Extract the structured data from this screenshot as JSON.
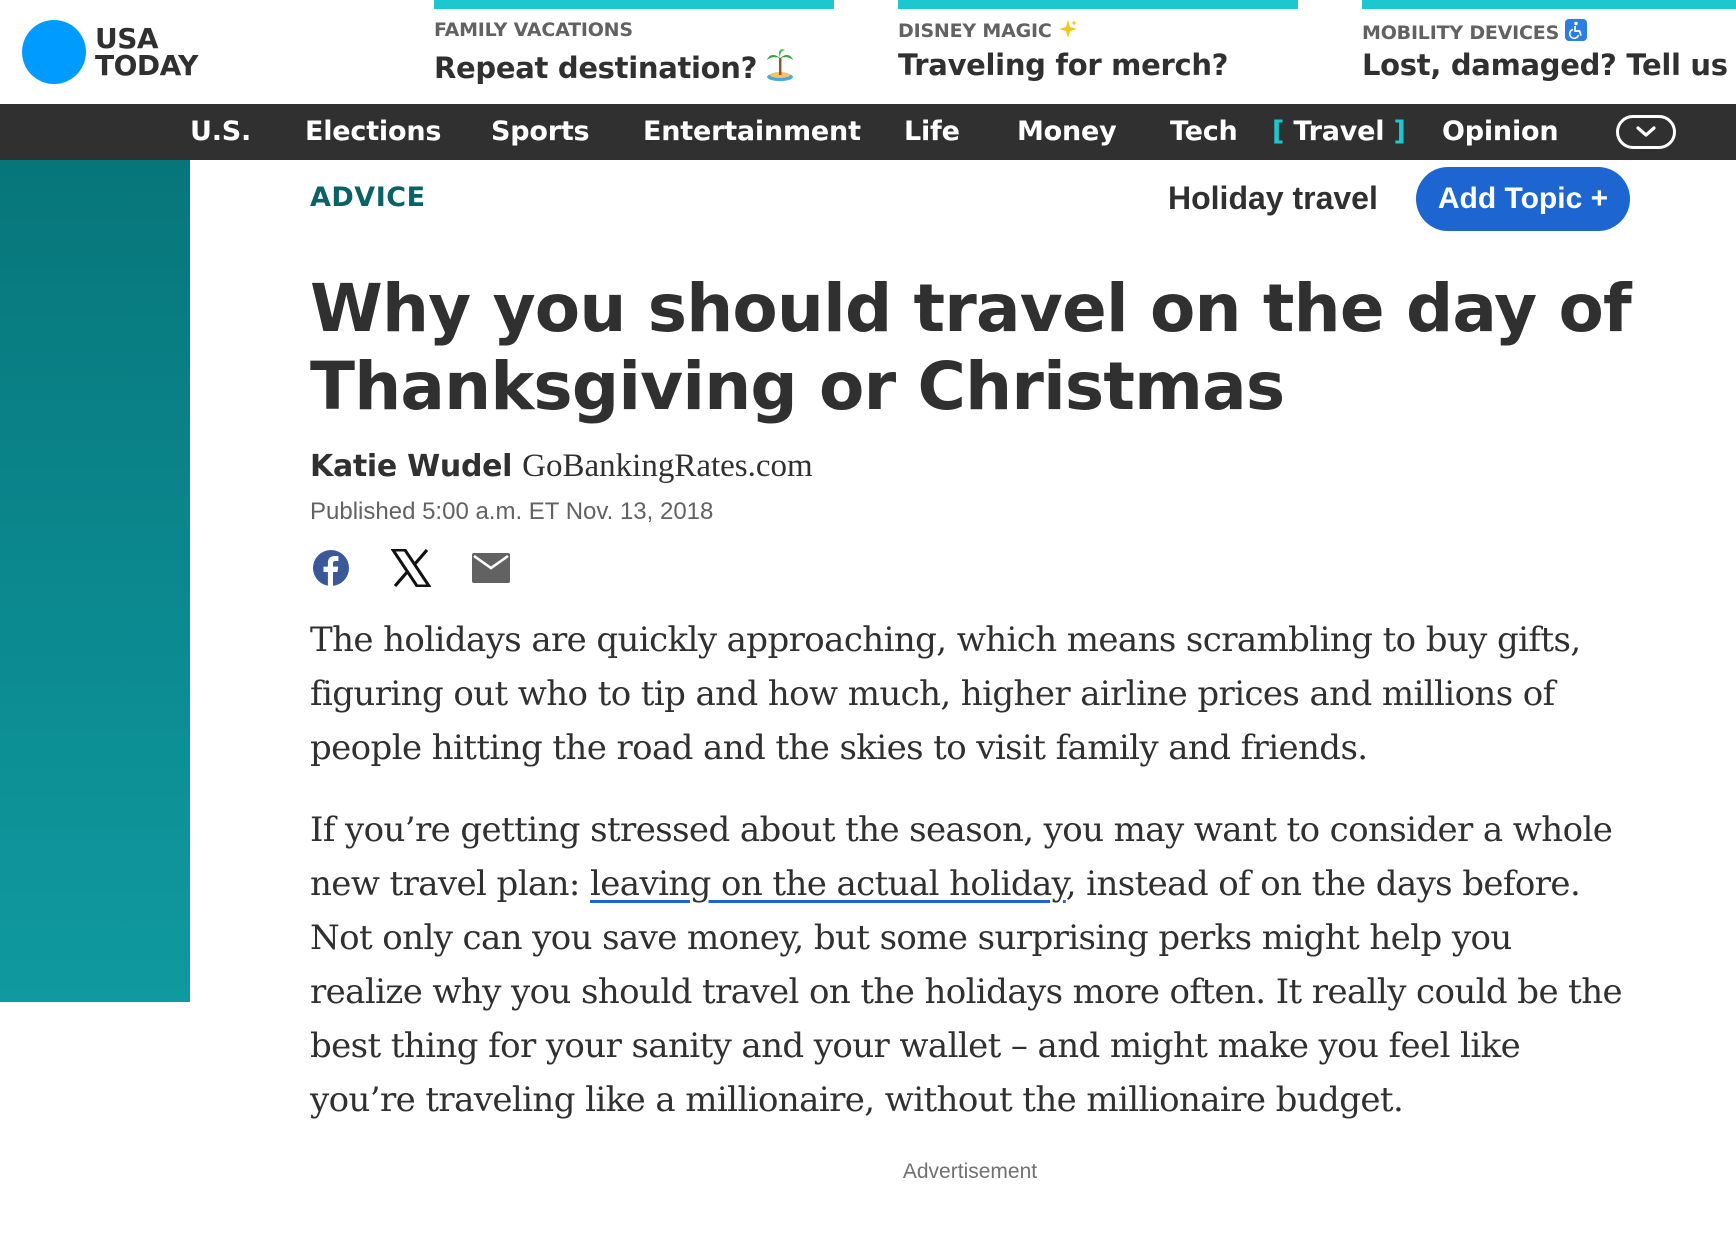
{
  "brand": {
    "logo_line1": "USA",
    "logo_line2": "TODAY",
    "logo_color": "#009bff"
  },
  "promos": [
    {
      "kicker": "FAMILY VACATIONS",
      "kicker_icon": "",
      "title": "Repeat destination?",
      "title_icon": "desert-island-emoji"
    },
    {
      "kicker": "DISNEY MAGIC",
      "kicker_icon": "sparkles-emoji",
      "title": "Traveling for merch?",
      "title_icon": ""
    },
    {
      "kicker": "MOBILITY DEVICES",
      "kicker_icon": "wheelchair-symbol-emoji",
      "title": "Lost, damaged? Tell us",
      "title_icon": ""
    }
  ],
  "nav": {
    "items": [
      {
        "label": "U.S."
      },
      {
        "label": "Elections"
      },
      {
        "label": "Sports"
      },
      {
        "label": "Entertainment"
      },
      {
        "label": "Life"
      },
      {
        "label": "Money"
      },
      {
        "label": "Tech"
      },
      {
        "label": "Travel",
        "active": true
      },
      {
        "label": "Opinion"
      }
    ],
    "more_icon": "chevron-down-icon",
    "active_bracket_open": "[",
    "active_bracket_close": "]"
  },
  "article": {
    "section": "ADVICE",
    "topic": "Holiday travel",
    "add_topic_label": "Add Topic +",
    "headline": "Why you should travel on the day of Thanksgiving or Christmas",
    "author": "Katie Wudel",
    "source": "GoBankingRates.com",
    "published": "Published 5:00 a.m. ET Nov. 13, 2018",
    "share_icons": [
      "facebook-icon",
      "x-icon",
      "email-icon"
    ],
    "paragraph1": "The holidays are quickly approaching, which means scrambling to buy gifts, figuring out who to tip and how much, higher airline prices and millions of people hitting the road and the skies to visit family and friends.",
    "paragraph2_before": "If you’re getting stressed about the season, you may want to consider a whole new travel plan: ",
    "paragraph2_link": "leaving on the actual holiday",
    "paragraph2_after": ", instead of on the days before. Not only can you save money, but some surprising perks might help you realize why you should travel on the holidays more often. It really could be the best thing for your sanity and your wallet – and might make you feel like you’re traveling like a millionaire, without the millionaire budget.",
    "ad_label": "Advertisement"
  },
  "colors": {
    "accent_teal": "#1cc7d0",
    "nav_bg": "#303030",
    "section_teal": "#0a6166",
    "button_blue": "#1d65d0",
    "rail_teal": "#0b8a90"
  }
}
